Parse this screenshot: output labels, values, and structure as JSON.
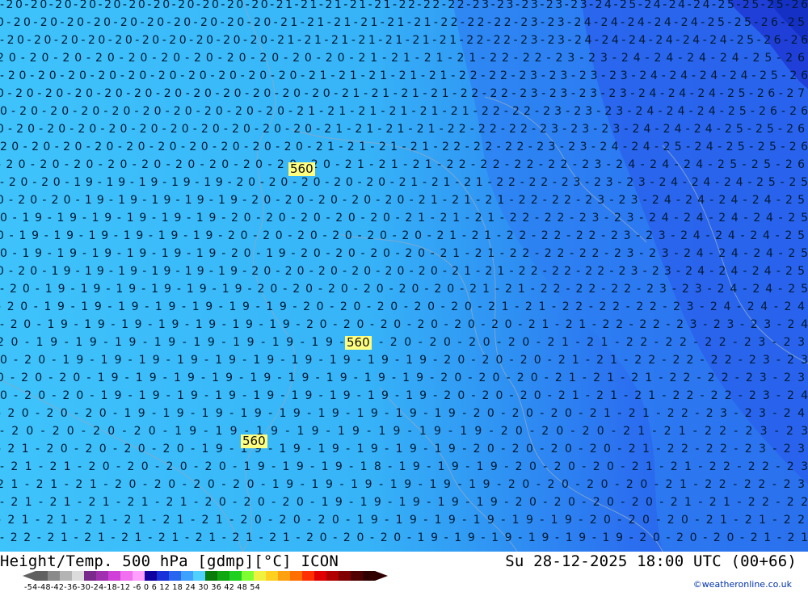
{
  "map": {
    "height_label": "560",
    "height_labels_count": 3,
    "temperature_rows": [
      "-20 20 20 20 20 20 20 20 20 20 20 21 21 21 21 21 22 22 22 23 23 23 23 23 24 25 24 24 24 25 25 25 26",
      "0 20 20 20 20 20 20 20 20 20 20 21 21 21 21 21 21 22 22 22 23 23 24 24 24 24 24 25 25 26 25",
      "-20 20 20 20 20 20 20 20 20 20 21 21 21 21 21 21 21 22 22 23 23 24 24 24 24 24 24 25 26 26",
      "20 20 20 20 20 20 20 20 20 20 20 21 21 21 21 22 22 23 23 24 24 24 24 25 26",
      "-20 20 20 20 20 20 20 20 20 20 21 21 21 21 21 22 22 23 23 23 23 24 24 24 24 25 26",
      "0 20 20 20 20 20 20 20 20 20 20 20 21 21 21 21 22 22 23 23 23 23 24 24 24 25 26 27",
      "0 20 20 20 20 20 20 20 20 20 21 21 21 21 21 21 22 22 23 23 23 24 24 24 25 26 26",
      "0 20 20 20 20 20 20 20 20 20 20 21 21 21 21 22 22 22 23 23 23 24 24 24 25 25 26",
      "20 20 20 20 20 20 20 20 20 20 21 21 21 21 22 22 22 23 23 24 24 25 24 25 25 26",
      "-20 20 20 20 20 20 20 20 20 20 21 21 21 22 22 22 22 23 24 24 24 25 25 26",
      "-20 20 19 19 19 19 19 20 20 20 20 20 21 21 21 22 22 23 23 23 24 24 24 25 25",
      "0 20 20 19 19 19 19 19 20 20 20 20 20 21 21 21 22 22 23 23 24 24 24 24 25",
      "0 19 19 19 19 19 19 20 20 20 20 20 21 21 21 22 22 23 23 24 24 24 24 25",
      "0 19 19 19 19 19 19 20 20 20 20 20 20 21 21 22 22 22 23 23 24 24 24 25",
      "0 19 19 19 19 19 19 20 19 20 20 20 20 21 21 22 22 22 23 23 24 24 24 25",
      "0 20 19 19 19 19 19 19 20 20 20 20 20 20 21 21 22 22 22 23 23 24 24 24 25",
      "-20 19 19 19 19 19 19 20 20 20 20 20 20 21 21 22 22 22 23 23 24 24 25",
      "-20 19 19 19 19 19 19 19 20 20 20 20 20 21 21 22 22 22 23 24 24 24",
      "-20 19 19 19 19 19 19 19 20 20 20 20 20 20 21 21 22 22 23 23 23 24",
      "20 19 19 19 19 19 19 19 19 19 20 20 20 20 21 21 22 22 22 23 23",
      "0 20 19 19 19 19 19 19 19 19 19 19 20 20 20 21 21 22 22 22 23 23",
      "0 20 20 19 19 19 19 19 19 19 19 19 20 20 20 21 21 21 22 22 23 23",
      "0 20 20 19 19 19 19 19 19 19 19 19 20 20 20 21 21 21 22 22 23 24",
      "-20 20 20 19 19 19 19 19 19 19 19 19 20 20 20 21 21 22 23 23 24",
      "-20 20 20 20 19 19 19 19 19 19 19 19 20 20 20 21 21 22 23 23",
      "-21 20 20 20 20 19 19 19 19 19 19 19 20 20 20 20 21 22 22 23 23",
      "-21 21 20 20 20 20 19 19 19 18 19 19 19 20 20 20 21 21 22 22 23",
      "21 21 21 20 20 20 20 19 19 19 19 19 19 20 20 20 20 21 22 22 23",
      "-21 21 21 21 21 20 20 20 19 19 19 19 19 20 20 20 20 21 21 22 22",
      "-21 21 21 21 21 21 20 20 20 19 19 19 19 19 19 20 20 20 21 21 22",
      "-22 21 21 21 21 21 21 21 20 20 20 19 19 19 19 19 19 20 20 20 21 21"
    ]
  },
  "footer": {
    "title_left": "Height/Temp. 500 hPa [gdmp][°C] ICON",
    "title_right": "Su 28-12-2025 18:00 UTC (00+66)",
    "scale_ticks": "-54-48-42-36-30-24-18-12 -6  0  6  12  18  24  30  36  42  48  54",
    "credit": "©weatheronline.co.uk"
  },
  "colors": {
    "ocean_light": "#3fc3fb",
    "mid_blue": "#2fa0f4",
    "deep_blue": "#2b66ee",
    "darkest_blue": "#1f44e0",
    "label_bg": "#ffff80",
    "scale": [
      "#606060",
      "#8a8a8a",
      "#b4b4b4",
      "#dcdcdc",
      "#7a2a8a",
      "#a030b0",
      "#d040d8",
      "#f070f0",
      "#ffa0ff",
      "#1000a0",
      "#1a30d8",
      "#2866f0",
      "#3ea0ff",
      "#50d0ff",
      "#0a7a0a",
      "#10a810",
      "#20d020",
      "#80ff30",
      "#f0f040",
      "#ffd020",
      "#ffa010",
      "#ff7000",
      "#ff3000",
      "#e00000",
      "#b00000",
      "#800000",
      "#500000",
      "#300000"
    ]
  }
}
